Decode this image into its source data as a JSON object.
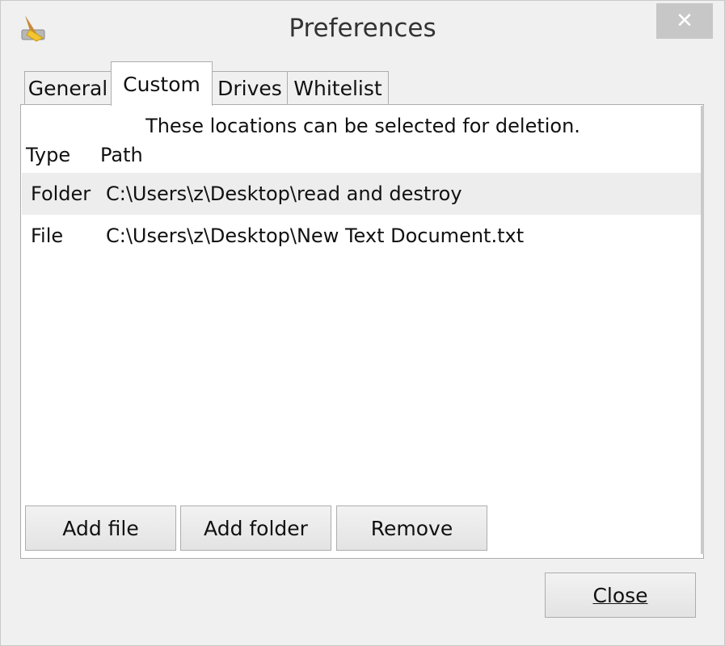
{
  "window": {
    "title": "Preferences",
    "icon": "broom-icon",
    "close_glyph": "✕"
  },
  "tabs": [
    {
      "label": "General",
      "active": false
    },
    {
      "label": "Custom",
      "active": true
    },
    {
      "label": "Drives",
      "active": false
    },
    {
      "label": "Whitelist",
      "active": false
    }
  ],
  "custom": {
    "notice": "These locations can be selected for deletion.",
    "columns": [
      "Type",
      "Path"
    ],
    "rows": [
      {
        "type": "Folder",
        "path": "C:\\Users\\z\\Desktop\\read and destroy",
        "selected": true
      },
      {
        "type": "File",
        "path": "C:\\Users\\z\\Desktop\\New Text Document.txt",
        "selected": false
      }
    ],
    "buttons": {
      "add_file": "Add file",
      "add_folder": "Add folder",
      "remove": "Remove"
    }
  },
  "footer": {
    "close_label": "Close"
  },
  "colors": {
    "selected_row": "#ededed",
    "close_x_bg": "#c7c7c7"
  }
}
